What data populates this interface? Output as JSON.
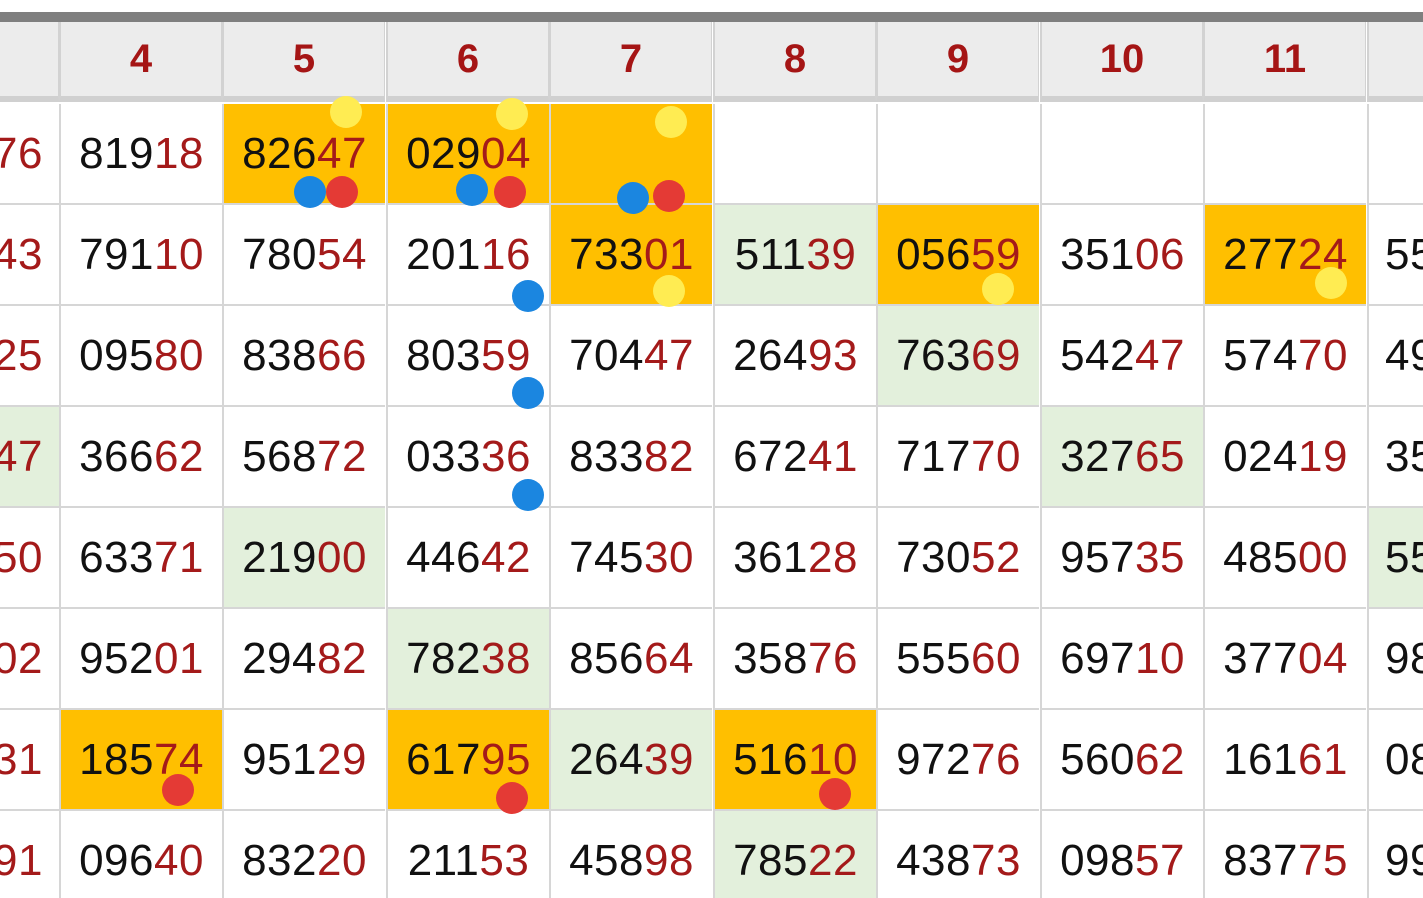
{
  "colors": {
    "header_bg": "#ececec",
    "header_text": "#a51515",
    "digit_head": "#111111",
    "digit_tail": "#a41a1a",
    "highlight_orange": "#ffbf00",
    "highlight_green": "#e3f0dc",
    "marker_yellow": "#ffec52",
    "marker_blue": "#1b86e0",
    "marker_red": "#e43a35"
  },
  "columns": [
    "",
    "4",
    "5",
    "6",
    "7",
    "8",
    "9",
    "10",
    "11",
    ""
  ],
  "rows": [
    {
      "cells": [
        {
          "head": "",
          "tail": "76"
        },
        {
          "head": "819",
          "tail": "18"
        },
        {
          "head": "826",
          "tail": "47",
          "bg": "orange"
        },
        {
          "head": "029",
          "tail": "04",
          "bg": "orange"
        },
        {
          "head": "",
          "tail": "",
          "bg": "orange"
        },
        {
          "head": "",
          "tail": ""
        },
        {
          "head": "",
          "tail": ""
        },
        {
          "head": "",
          "tail": ""
        },
        {
          "head": "",
          "tail": ""
        },
        {
          "head": "",
          "tail": ""
        }
      ]
    },
    {
      "cells": [
        {
          "head": "",
          "tail": "43"
        },
        {
          "head": "791",
          "tail": "10"
        },
        {
          "head": "780",
          "tail": "54"
        },
        {
          "head": "201",
          "tail": "16"
        },
        {
          "head": "733",
          "tail": "01",
          "bg": "orange"
        },
        {
          "head": "511",
          "tail": "39",
          "bg": "green"
        },
        {
          "head": "056",
          "tail": "59",
          "bg": "orange"
        },
        {
          "head": "351",
          "tail": "06"
        },
        {
          "head": "277",
          "tail": "24",
          "bg": "orange"
        },
        {
          "head": "55",
          "tail": ""
        }
      ]
    },
    {
      "cells": [
        {
          "head": "",
          "tail": "25"
        },
        {
          "head": "095",
          "tail": "80"
        },
        {
          "head": "838",
          "tail": "66"
        },
        {
          "head": "803",
          "tail": "59"
        },
        {
          "head": "704",
          "tail": "47"
        },
        {
          "head": "264",
          "tail": "93"
        },
        {
          "head": "763",
          "tail": "69",
          "bg": "green"
        },
        {
          "head": "542",
          "tail": "47"
        },
        {
          "head": "574",
          "tail": "70"
        },
        {
          "head": "49",
          "tail": ""
        }
      ]
    },
    {
      "cells": [
        {
          "head": "",
          "tail": "47",
          "bg": "green"
        },
        {
          "head": "366",
          "tail": "62"
        },
        {
          "head": "568",
          "tail": "72"
        },
        {
          "head": "033",
          "tail": "36"
        },
        {
          "head": "833",
          "tail": "82"
        },
        {
          "head": "672",
          "tail": "41"
        },
        {
          "head": "717",
          "tail": "70"
        },
        {
          "head": "327",
          "tail": "65",
          "bg": "green"
        },
        {
          "head": "024",
          "tail": "19"
        },
        {
          "head": "35",
          "tail": ""
        }
      ]
    },
    {
      "cells": [
        {
          "head": "",
          "tail": "50"
        },
        {
          "head": "633",
          "tail": "71"
        },
        {
          "head": "219",
          "tail": "00",
          "bg": "green"
        },
        {
          "head": "446",
          "tail": "42"
        },
        {
          "head": "745",
          "tail": "30"
        },
        {
          "head": "361",
          "tail": "28"
        },
        {
          "head": "730",
          "tail": "52"
        },
        {
          "head": "957",
          "tail": "35"
        },
        {
          "head": "485",
          "tail": "00"
        },
        {
          "head": "55",
          "tail": "",
          "bg": "green"
        }
      ]
    },
    {
      "cells": [
        {
          "head": "",
          "tail": "02"
        },
        {
          "head": "952",
          "tail": "01"
        },
        {
          "head": "294",
          "tail": "82"
        },
        {
          "head": "782",
          "tail": "38",
          "bg": "green"
        },
        {
          "head": "856",
          "tail": "64"
        },
        {
          "head": "358",
          "tail": "76"
        },
        {
          "head": "555",
          "tail": "60"
        },
        {
          "head": "697",
          "tail": "10"
        },
        {
          "head": "377",
          "tail": "04"
        },
        {
          "head": "98",
          "tail": ""
        }
      ]
    },
    {
      "cells": [
        {
          "head": "",
          "tail": "31"
        },
        {
          "head": "185",
          "tail": "74",
          "bg": "orange"
        },
        {
          "head": "951",
          "tail": "29"
        },
        {
          "head": "617",
          "tail": "95",
          "bg": "orange"
        },
        {
          "head": "264",
          "tail": "39",
          "bg": "green"
        },
        {
          "head": "516",
          "tail": "10",
          "bg": "orange"
        },
        {
          "head": "972",
          "tail": "76"
        },
        {
          "head": "560",
          "tail": "62"
        },
        {
          "head": "161",
          "tail": "61"
        },
        {
          "head": "08",
          "tail": ""
        }
      ]
    },
    {
      "cells": [
        {
          "head": "",
          "tail": "91"
        },
        {
          "head": "096",
          "tail": "40"
        },
        {
          "head": "832",
          "tail": "20"
        },
        {
          "head": "211",
          "tail": "53"
        },
        {
          "head": "458",
          "tail": "98"
        },
        {
          "head": "785",
          "tail": "22",
          "bg": "green"
        },
        {
          "head": "438",
          "tail": "73"
        },
        {
          "head": "098",
          "tail": "57"
        },
        {
          "head": "837",
          "tail": "75"
        },
        {
          "head": "99",
          "tail": ""
        }
      ]
    }
  ],
  "markers": [
    {
      "color": "yellow",
      "row": 0,
      "col": 2
    },
    {
      "color": "blue",
      "row": 0,
      "col": 2
    },
    {
      "color": "red",
      "row": 0,
      "col": 2
    },
    {
      "color": "yellow",
      "row": 0,
      "col": 3
    },
    {
      "color": "blue",
      "row": 0,
      "col": 3
    },
    {
      "color": "red",
      "row": 0,
      "col": 3
    },
    {
      "color": "yellow",
      "row": 0,
      "col": 4
    },
    {
      "color": "blue",
      "row": 0,
      "col": 4
    },
    {
      "color": "red",
      "row": 0,
      "col": 4
    },
    {
      "color": "yellow",
      "row": 1,
      "col": 4
    },
    {
      "color": "yellow",
      "row": 1,
      "col": 6
    },
    {
      "color": "yellow",
      "row": 1,
      "col": 8
    },
    {
      "color": "blue",
      "row": 1,
      "col": 3
    },
    {
      "color": "blue",
      "row": 2,
      "col": 3
    },
    {
      "color": "blue",
      "row": 3,
      "col": 3
    },
    {
      "color": "red",
      "row": 6,
      "col": 1
    },
    {
      "color": "red",
      "row": 6,
      "col": 3
    },
    {
      "color": "red",
      "row": 6,
      "col": 5
    }
  ]
}
